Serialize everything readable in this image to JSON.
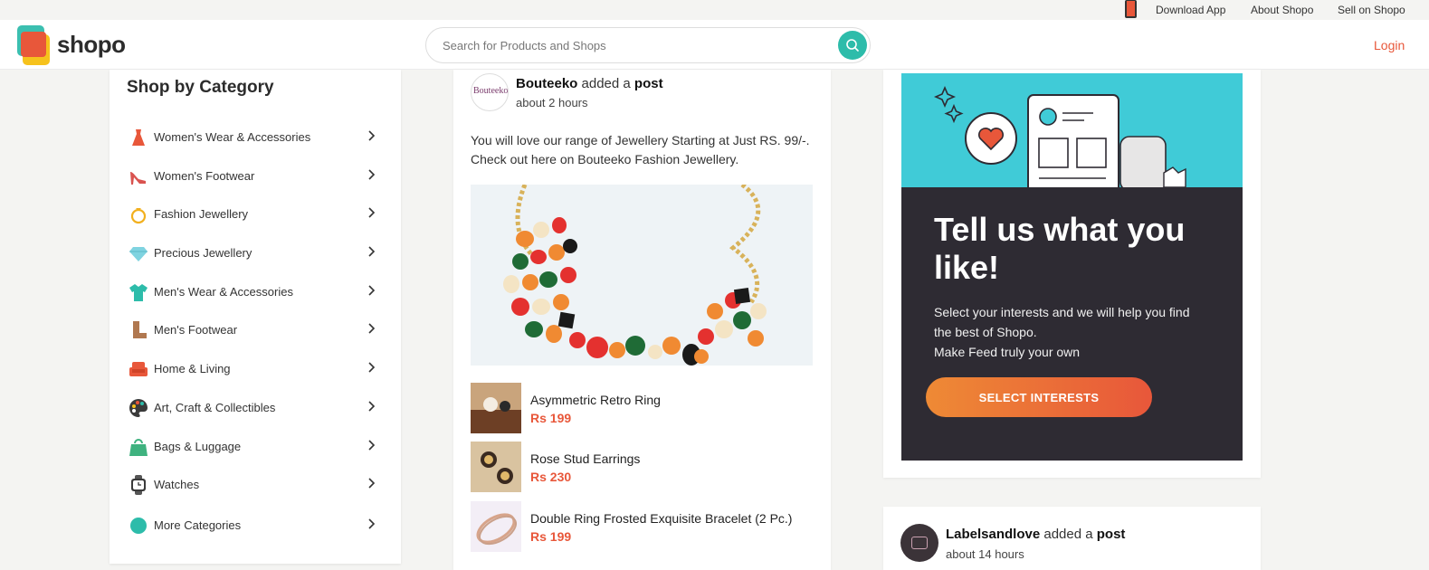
{
  "topbar": {
    "download_app": "Download App",
    "about": "About Shopo",
    "sell": "Sell on Shopo"
  },
  "header": {
    "logo_text": "shopo",
    "search_placeholder": "Search for Products and Shops",
    "login": "Login"
  },
  "sidebar": {
    "title": "Shop by Category",
    "items": [
      {
        "label": "Women's Wear & Accessories",
        "icon": "dress-icon"
      },
      {
        "label": "Women's Footwear",
        "icon": "heel-icon"
      },
      {
        "label": "Fashion Jewellery",
        "icon": "ring-icon"
      },
      {
        "label": "Precious Jewellery",
        "icon": "diamond-icon"
      },
      {
        "label": "Men's Wear & Accessories",
        "icon": "shirt-icon"
      },
      {
        "label": "Men's Footwear",
        "icon": "boot-icon"
      },
      {
        "label": "Home & Living",
        "icon": "sofa-icon"
      },
      {
        "label": "Art, Craft & Collectibles",
        "icon": "palette-icon"
      },
      {
        "label": "Bags & Luggage",
        "icon": "bag-icon"
      },
      {
        "label": "Watches",
        "icon": "watch-icon"
      },
      {
        "label": "More Categories",
        "icon": "circle-icon"
      }
    ]
  },
  "post": {
    "author": "Bouteeko",
    "avatar_text": "Bouteeko",
    "action_mid": " added a ",
    "action_end": "post",
    "time": "about 2 hours",
    "text": "You will love our range of Jewellery Starting at Just RS. 99/-. Check out here on Bouteeko Fashion Jewellery.",
    "products": [
      {
        "name": "Asymmetric Retro Ring",
        "price": "Rs 199"
      },
      {
        "name": "Rose Stud Earrings",
        "price": "Rs 230"
      },
      {
        "name": "Double Ring Frosted Exquisite Bracelet (2 Pc.)",
        "price": "Rs 199"
      }
    ]
  },
  "promo": {
    "heading": "Tell us what you like!",
    "body_line1": "Select your interests and we will help you find the best of Shopo.",
    "body_line2": "Make Feed truly your own",
    "cta": "SELECT INTERESTS"
  },
  "post2": {
    "author": "Labelsandlove",
    "action_mid": " added a ",
    "action_end": "post",
    "time": "about 14 hours"
  },
  "colors": {
    "accent": "#e8573a",
    "teal": "#2dbcaa",
    "promo_dark": "#2e2b33",
    "promo_sky": "#40cbd7"
  }
}
